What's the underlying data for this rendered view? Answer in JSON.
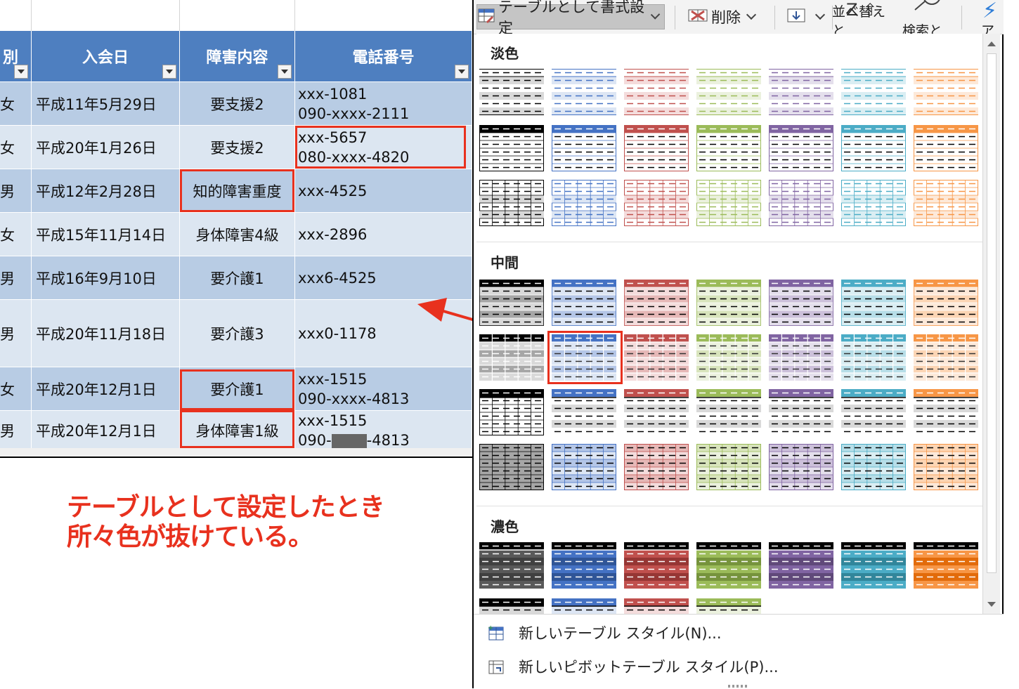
{
  "sheet": {
    "headers": [
      "別",
      "入会日",
      "障害内容",
      "電話番号"
    ],
    "rows": [
      {
        "gender": "女",
        "date": "平成11年5月29日",
        "disability": "要支援2",
        "tel1": "xxx-1081",
        "tel2": "090-xxxx-2111"
      },
      {
        "gender": "女",
        "date": "平成20年1月26日",
        "disability": "要支援2",
        "tel1": "xxx-5657",
        "tel2": "080-xxxx-4820"
      },
      {
        "gender": "男",
        "date": "平成12年2月28日",
        "disability": "知的障害重度",
        "tel1": "xxx-4525",
        "tel2": ""
      },
      {
        "gender": "女",
        "date": "平成15年11月14日",
        "disability": "身体障害4級",
        "tel1": "xxx-2896",
        "tel2": ""
      },
      {
        "gender": "男",
        "date": "平成16年9月10日",
        "disability": "要介護1",
        "tel1": "xxx6-4525",
        "tel2": ""
      },
      {
        "gender": "男",
        "date": "平成20年11月18日",
        "disability": "要介護3",
        "tel1": "xxx0-1178",
        "tel2": ""
      },
      {
        "gender": "女",
        "date": "平成20年12月1日",
        "disability": "要介護1",
        "tel1": "xxx-1515",
        "tel2": "090-xxxx-4813"
      },
      {
        "gender": "男",
        "date": "平成20年12月1日",
        "disability": "身体障害1級",
        "tel1": "xxx-1515",
        "tel2_prefix": "090-",
        "tel2_suffix": "-4813"
      }
    ]
  },
  "caption": {
    "line1": "テーブルとして設定したとき",
    "line2": "所々色が抜けている。"
  },
  "ribbon": {
    "format_as_table": "テーブルとして書式設定",
    "delete": "削除",
    "sort_filter": "並べ替えと",
    "find_select": "検索と",
    "more": "ア"
  },
  "gallery": {
    "sections": {
      "light": "淡色",
      "medium": "中間",
      "dark": "濃色"
    },
    "palette": [
      {
        "name": "black",
        "main": "#000000",
        "light": "#d9d9d9",
        "mid": "#a6a6a6",
        "dark": "#595959",
        "dark2": "#404040"
      },
      {
        "name": "blue",
        "main": "#4472c4",
        "light": "#dde6f4",
        "mid": "#b4c6e7",
        "dark": "#4472c4",
        "dark2": "#2f5597"
      },
      {
        "name": "red",
        "main": "#c0504d",
        "light": "#f4dcdc",
        "mid": "#e6b8b7",
        "dark": "#c0504d",
        "dark2": "#963634"
      },
      {
        "name": "green",
        "main": "#9bbb59",
        "light": "#ebf1de",
        "mid": "#d8e4bc",
        "dark": "#9bbb59",
        "dark2": "#76933c"
      },
      {
        "name": "purple",
        "main": "#8064a2",
        "light": "#e4dfec",
        "mid": "#ccc0da",
        "dark": "#8064a2",
        "dark2": "#60497a"
      },
      {
        "name": "teal",
        "main": "#4bacc6",
        "light": "#daeef3",
        "mid": "#b7dee8",
        "dark": "#4bacc6",
        "dark2": "#31869b"
      },
      {
        "name": "orange",
        "main": "#f79646",
        "light": "#fde9d9",
        "mid": "#fcd5b4",
        "dark": "#f79646",
        "dark2": "#e26b0a"
      }
    ],
    "selected": {
      "section": "medium",
      "row": 2,
      "column": 2
    }
  },
  "menu": {
    "new_table_style": "新しいテーブル スタイル(N)...",
    "new_pivot_style": "新しいピボットテーブル スタイル(P)..."
  },
  "colors": {
    "header": "#4e7fc0",
    "band_dark": "#b8cce4",
    "band_light": "#dce6f1",
    "annotation": "#e8311e"
  }
}
